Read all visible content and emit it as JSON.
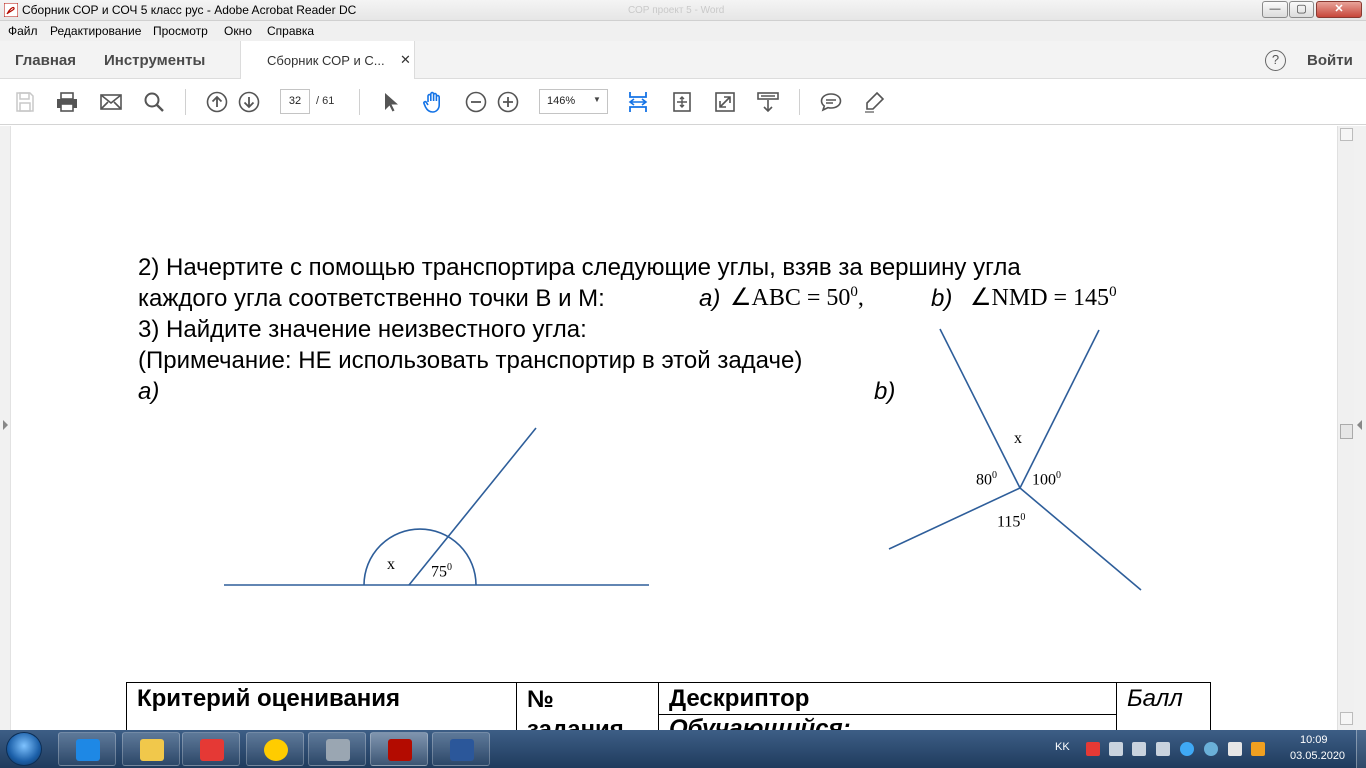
{
  "window": {
    "title": "Сборник СОР и СОЧ 5 класс рус - Adobe Acrobat Reader DC",
    "ghost_title": "СОР проект 5 - Word",
    "minimize": "—",
    "maximize": "▢",
    "close": "✕"
  },
  "menu": [
    "Файл",
    "Редактирование",
    "Просмотр",
    "Окно",
    "Справка"
  ],
  "tabs": {
    "home": "Главная",
    "tools": "Инструменты",
    "document": "Сборник СОР и С...",
    "close": "✕",
    "help": "?",
    "sign_in": "Войти"
  },
  "toolbar": {
    "current_page": "32",
    "total_pages": "/ 61",
    "zoom": "146%",
    "zoom_caret": "▼"
  },
  "document": {
    "task2_line1": "2) Начертите с помощью транспортира следующие углы, взяв за вершину угла",
    "task2_line2": "каждого угла соответственно точки В и М:",
    "task2_a_label": "a)",
    "task2_a_expr": "∠ABC = 50",
    "task2_a_sup": "0",
    "task2_b_label": "b)",
    "task2_b_expr": "∠NMD = 145",
    "task2_b_sup": "0",
    "comma": ",",
    "task3_line1": "3) Найдите значение неизвестного угла:",
    "task3_note": "(Примечание: НЕ  использовать транспортир в этой задаче)",
    "task3_a": "a)",
    "task3_b": "b)",
    "fig_a_x": "x",
    "fig_a_angle": "75",
    "fig_b_x": "x",
    "fig_b_angle1": "80",
    "fig_b_angle2": "100",
    "fig_b_angle3": "115",
    "degree_sup": "0",
    "table": {
      "col1": "Критерий оценивания",
      "col2_line1": "№",
      "col2_line2": "задания",
      "col3_top": "Дескриптор",
      "col3_bottom": "Обучающийся:",
      "col4": "Балл"
    }
  },
  "taskbar": {
    "language": "KK",
    "time": "10:09",
    "date": "03.05.2020"
  }
}
